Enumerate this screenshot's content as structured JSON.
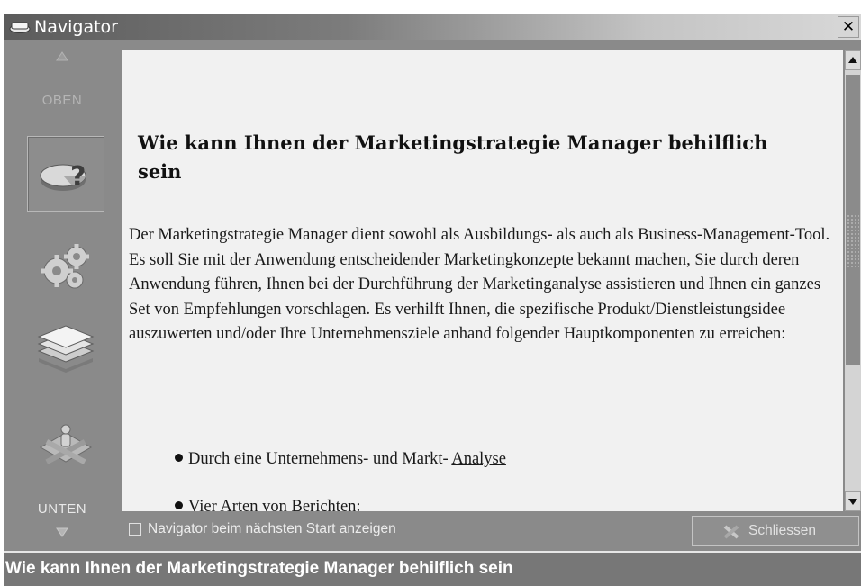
{
  "window": {
    "title": "Navigator",
    "close_glyph": "✕"
  },
  "sidebar": {
    "up_label": "OBEN",
    "down_label": "UNTEN",
    "items": [
      {
        "icon": "help-pie-chart-icon",
        "selected": true
      },
      {
        "icon": "gears-icon",
        "selected": false
      },
      {
        "icon": "layers-icon",
        "selected": false
      },
      {
        "icon": "tools-person-icon",
        "selected": false
      }
    ]
  },
  "content": {
    "heading": "Wie kann Ihnen der Marketingstrategie Manager behilflich sein",
    "paragraph": "Der Marketingstrategie Manager dient sowohl als Ausbildungs- als auch als Business-Management-Tool. Es soll Sie mit der Anwendung entscheidender Marketingkonzepte bekannt machen, Sie durch deren Anwendung führen, Ihnen bei der Durchführung der Marketinganalyse assistieren und Ihnen ein ganzes Set von Empfehlungen vorschlagen. Es verhilft Ihnen, die spezifische Produkt/Dienstleistungsidee auszuwerten und/oder Ihre Unternehmensziele anhand folgender Hauptkomponenten zu erreichen:",
    "bullets": [
      {
        "text": "Durch eine Unternehmens- und Markt- ",
        "link": "Analyse"
      },
      {
        "text": "Vier Arten von Berichten:",
        "link": ""
      }
    ]
  },
  "footer": {
    "checkbox_label": "Navigator beim nächsten Start anzeigen",
    "checkbox_checked": false,
    "close_button_label": "Schliessen"
  },
  "status": {
    "text": "Wie kann Ihnen der Marketingstrategie Manager behilflich sein"
  }
}
